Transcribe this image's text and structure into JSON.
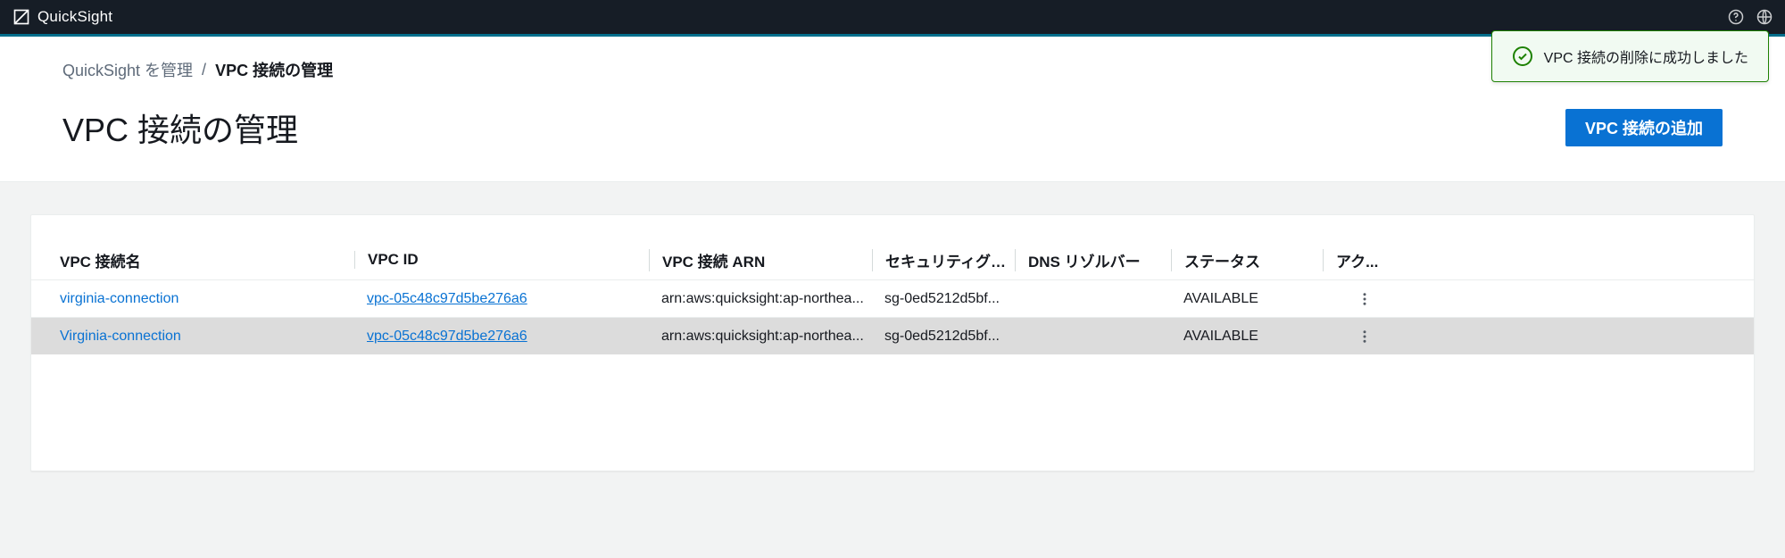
{
  "brand": {
    "name": "QuickSight"
  },
  "breadcrumb": {
    "root": "QuickSight を管理",
    "sep": "/",
    "current": "VPC 接続の管理"
  },
  "page": {
    "title": "VPC 接続の管理",
    "add_button": "VPC 接続の追加"
  },
  "toast": {
    "message": "VPC 接続の削除に成功しました"
  },
  "table": {
    "headers": {
      "name": "VPC 接続名",
      "vpc_id": "VPC ID",
      "arn": "VPC 接続 ARN",
      "sg": "セキュリティグル...",
      "dns": "DNS リゾルバー",
      "status": "ステータス",
      "actions": "アク..."
    },
    "rows": [
      {
        "name": "virginia-connection",
        "vpc_id": "vpc-05c48c97d5be276a6",
        "arn": "arn:aws:quicksight:ap-northea...",
        "sg": "sg-0ed5212d5bf...",
        "dns": "",
        "status": "AVAILABLE"
      },
      {
        "name": "Virginia-connection",
        "vpc_id": "vpc-05c48c97d5be276a6",
        "arn": "arn:aws:quicksight:ap-northea...",
        "sg": "sg-0ed5212d5bf...",
        "dns": "",
        "status": "AVAILABLE"
      }
    ]
  }
}
